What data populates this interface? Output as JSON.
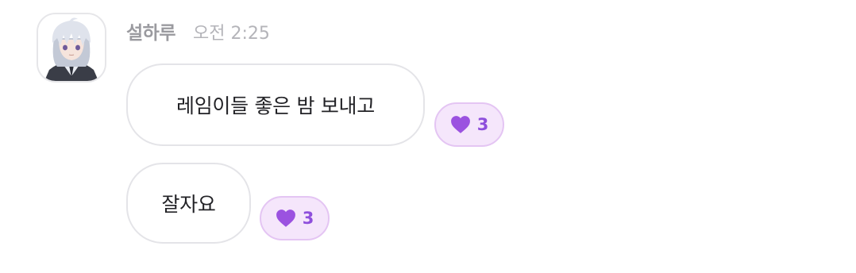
{
  "message_group": {
    "sender": {
      "name": "설하루",
      "avatar_icon": "anime-character-avatar"
    },
    "timestamp": "오전 2:25",
    "messages": [
      {
        "text": "레임이들 좋은 밤 보내고",
        "reaction": {
          "icon": "heart-icon",
          "count": "3"
        }
      },
      {
        "text": "잘자요",
        "reaction": {
          "icon": "heart-icon",
          "count": "3"
        }
      }
    ]
  },
  "colors": {
    "reaction_accent": "#8e4fdc",
    "reaction_bg": "#f5e6fb",
    "bubble_border": "#e4e4e8"
  }
}
